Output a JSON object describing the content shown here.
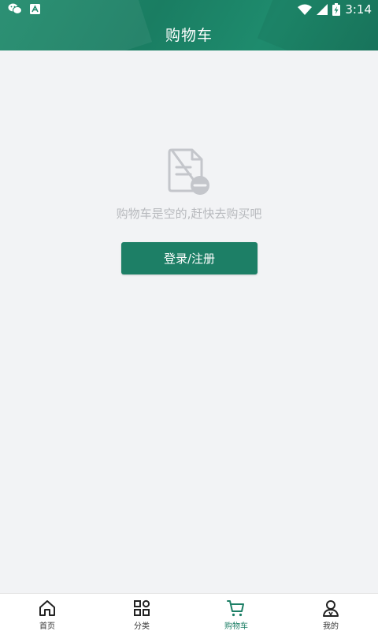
{
  "status_bar": {
    "time": "3:14",
    "colors": {
      "text": "#ffffff"
    }
  },
  "header": {
    "title": "购物车",
    "color": "#1d7f66"
  },
  "empty_state": {
    "message": "购物车是空的,赶快去购买吧",
    "icon": "document-minus-icon"
  },
  "login_button": {
    "label": "登录/注册",
    "color": "#1d7f66"
  },
  "tabbar": {
    "items": [
      {
        "label": "首页",
        "icon": "home-icon",
        "active": false
      },
      {
        "label": "分类",
        "icon": "category-grid-icon",
        "active": false
      },
      {
        "label": "购物车",
        "icon": "cart-icon",
        "active": true
      },
      {
        "label": "我的",
        "icon": "user-icon",
        "active": false
      }
    ],
    "active_color": "#1d7f66"
  }
}
